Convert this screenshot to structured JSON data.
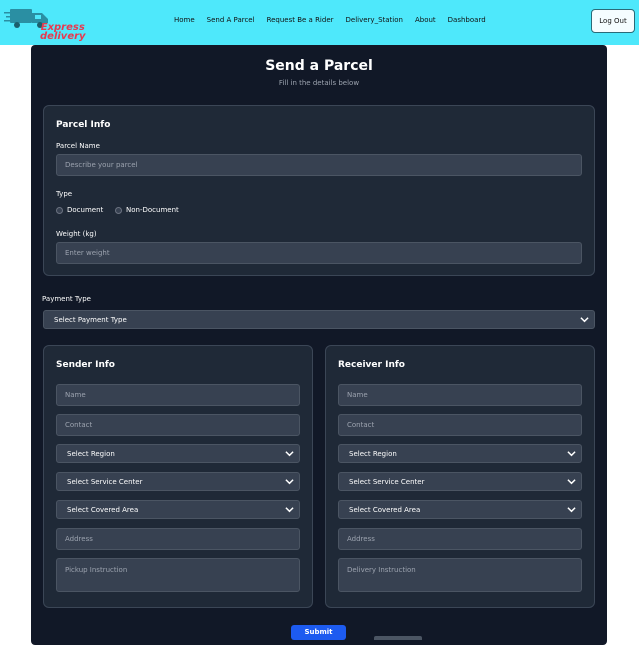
{
  "nav": {
    "logo_line1": "Express",
    "logo_line2": "delivery",
    "links": [
      "Home",
      "Send A Parcel",
      "Request Be a Rider",
      "Delivery_Station",
      "About",
      "Dashboard"
    ],
    "logout_label": "Log Out"
  },
  "page": {
    "title": "Send a Parcel",
    "subtitle": "Fill in the details below"
  },
  "parcel": {
    "title": "Parcel Info",
    "name_label": "Parcel Name",
    "name_placeholder": "Describe your parcel",
    "type_label": "Type",
    "type_options": [
      "Document",
      "Non-Document"
    ],
    "weight_label": "Weight (kg)",
    "weight_placeholder": "Enter weight"
  },
  "payment": {
    "label": "Payment Type",
    "selected": "Select Payment Type"
  },
  "sender": {
    "title": "Sender Info",
    "name_placeholder": "Name",
    "contact_placeholder": "Contact",
    "region": "Select Region",
    "service_center": "Select Service Center",
    "covered_area": "Select Covered Area",
    "address_placeholder": "Address",
    "instruction_placeholder": "Pickup Instruction"
  },
  "receiver": {
    "title": "Receiver Info",
    "name_placeholder": "Name",
    "contact_placeholder": "Contact",
    "region": "Select Region",
    "service_center": "Select Service Center",
    "covered_area": "Select Covered Area",
    "address_placeholder": "Address",
    "instruction_placeholder": "Delivery Instruction"
  },
  "submit_label": "Submit",
  "colors": {
    "nav_bg": "#4ee8fb",
    "panel_bg": "#111827",
    "card_bg": "#1f2937",
    "submit_bg": "#1d5bf0",
    "logo_red": "#e8384f"
  }
}
